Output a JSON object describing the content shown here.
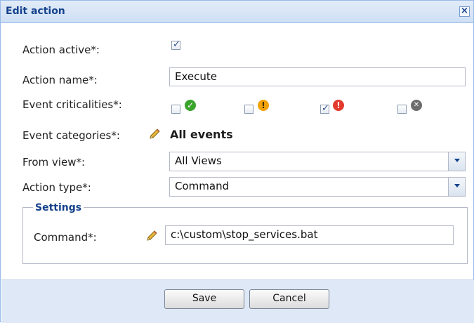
{
  "dialog": {
    "title": "Edit action",
    "close_glyph": "×",
    "close_icon": "close-icon"
  },
  "form": {
    "action_active": {
      "label": "Action active*:",
      "checked": true
    },
    "action_name": {
      "label": "Action name*:",
      "value": "Execute"
    },
    "event_criticalities": {
      "label": "Event criticalities*:",
      "items": [
        {
          "icon": "ok-icon",
          "color": "#3aa42c",
          "glyph": "✓",
          "checked": false
        },
        {
          "icon": "warning-icon",
          "color": "#f1a20a",
          "glyph": "!",
          "checked": false
        },
        {
          "icon": "error-icon",
          "color": "#e23b2e",
          "glyph": "!",
          "checked": true
        },
        {
          "icon": "unknown-icon",
          "color": "#6d6d6d",
          "glyph": "✕",
          "checked": false
        }
      ]
    },
    "event_categories": {
      "label": "Event categories*:",
      "value": "All events",
      "icon": "pencil-icon"
    },
    "from_view": {
      "label": "From view*:",
      "value": "All Views"
    },
    "action_type": {
      "label": "Action type*:",
      "value": "Command"
    }
  },
  "settings": {
    "legend": "Settings",
    "command": {
      "label": "Command*:",
      "value": "c:\\custom\\stop_services.bat",
      "icon": "pencil-icon"
    }
  },
  "buttons": {
    "save": "Save",
    "cancel": "Cancel"
  },
  "colors": {
    "title_text": "#15428b",
    "title_bar": "#cedff5",
    "footer_bg": "#dfe8f6",
    "border": "#99bbe8"
  }
}
